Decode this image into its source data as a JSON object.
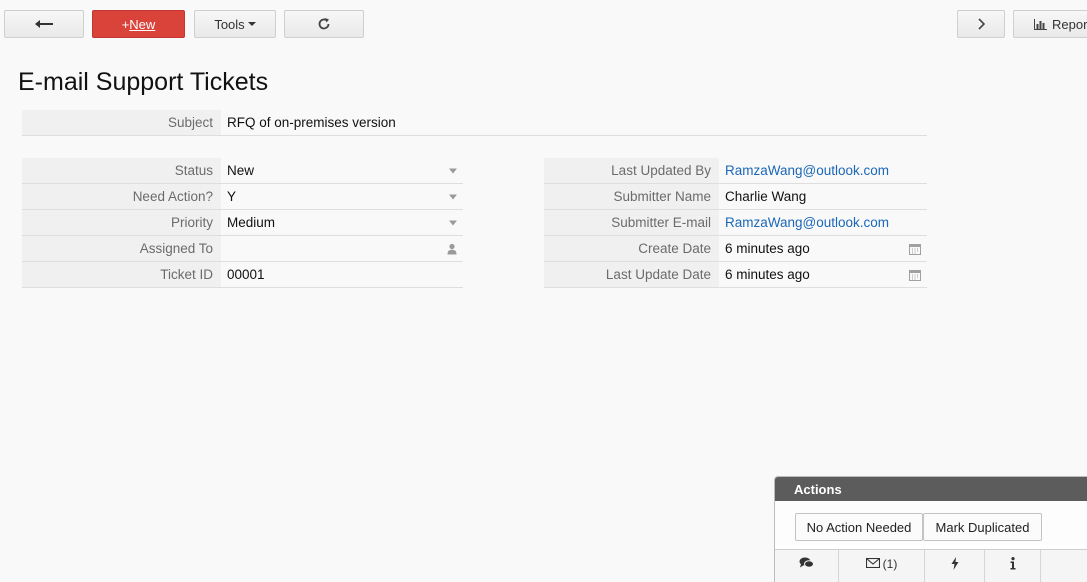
{
  "toolbar": {
    "new_label": "New",
    "new_prefix": "+",
    "tools_label": "Tools",
    "report_label": "Report"
  },
  "page": {
    "title": "E-mail Support Tickets"
  },
  "subject": {
    "label": "Subject",
    "value": "RFQ of on-premises version"
  },
  "left_fields": [
    {
      "label": "Status",
      "value": "New"
    },
    {
      "label": "Need Action?",
      "value": "Y"
    },
    {
      "label": "Priority",
      "value": "Medium"
    },
    {
      "label": "Assigned To",
      "value": ""
    },
    {
      "label": "Ticket ID",
      "value": "00001"
    }
  ],
  "right_fields": [
    {
      "label": "Last Updated By",
      "value": "RamzaWang@outlook.com"
    },
    {
      "label": "Submitter Name",
      "value": "Charlie Wang"
    },
    {
      "label": "Submitter E-mail",
      "value": "RamzaWang@outlook.com"
    },
    {
      "label": "Create Date",
      "value": "6 minutes ago"
    },
    {
      "label": "Last Update Date",
      "value": "6 minutes ago"
    }
  ],
  "actions": {
    "title": "Actions",
    "no_action_label": "No Action Needed",
    "mark_duplicated_label": "Mark Duplicated",
    "mail_count": "(1)"
  },
  "colors": {
    "accent_new": "#d9433a",
    "link": "#1a67b8",
    "panel_header": "#5c5c5c"
  }
}
